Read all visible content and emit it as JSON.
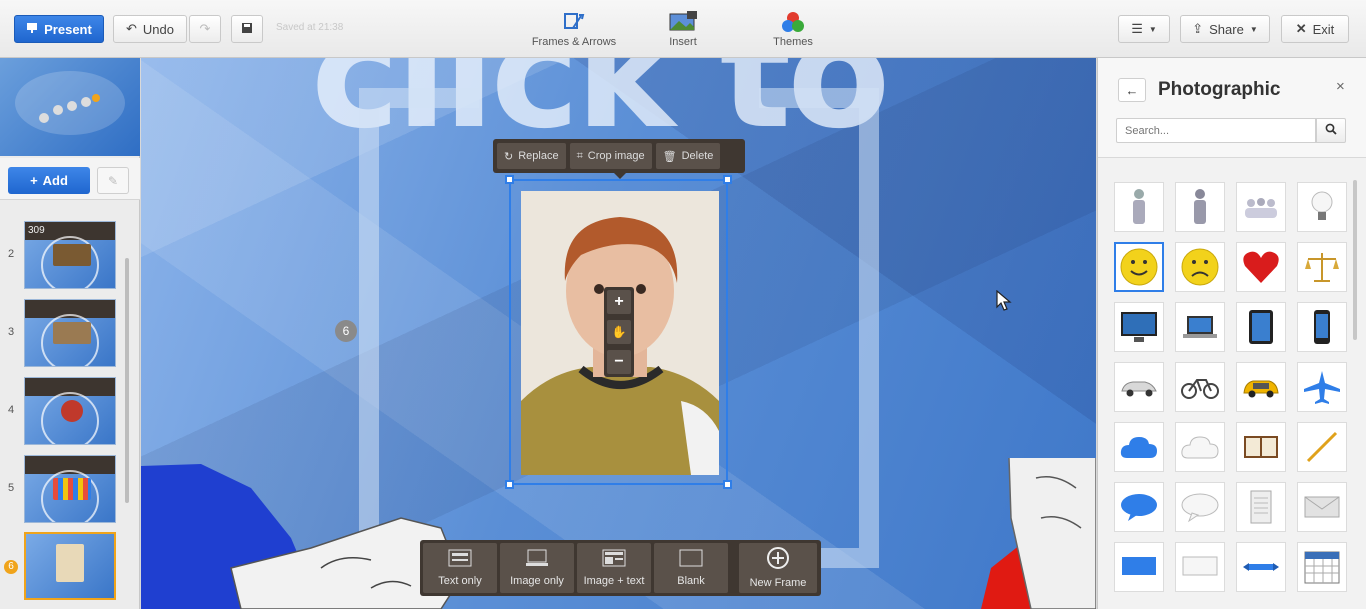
{
  "toolbar": {
    "present_label": "Present",
    "undo_label": "Undo",
    "saved_text": "Saved at 21:38",
    "share_label": "Share",
    "exit_label": "Exit",
    "nav": [
      {
        "label": "Frames & Arrows",
        "icon": "frames-arrows-icon"
      },
      {
        "label": "Insert",
        "icon": "insert-icon"
      },
      {
        "label": "Themes",
        "icon": "themes-icon"
      }
    ]
  },
  "sidebar": {
    "add_label": "Add",
    "slides": [
      {
        "number": "2",
        "header": "309"
      },
      {
        "number": "3",
        "header": ""
      },
      {
        "number": "4",
        "header": ""
      },
      {
        "number": "5",
        "header": ""
      },
      {
        "number": "6",
        "header": ""
      }
    ]
  },
  "canvas": {
    "title_text": "click to",
    "frame_number": "6",
    "context_menu": {
      "replace_label": "Replace",
      "crop_label": "Crop image",
      "delete_label": "Delete"
    },
    "zoom": {
      "plus": "+",
      "minus": "−"
    },
    "layouts": [
      {
        "label": "Text only"
      },
      {
        "label": "Image only"
      },
      {
        "label": "Image + text"
      },
      {
        "label": "Blank"
      },
      {
        "label": "New Frame"
      }
    ]
  },
  "panel": {
    "title": "Photographic",
    "search_placeholder": "Search...",
    "symbols": [
      "person-gray-icon",
      "person-gray-2-icon",
      "group-icon",
      "lightbulb-icon",
      "smiley-happy-icon",
      "smiley-sad-icon",
      "heart-icon",
      "scales-icon",
      "monitor-icon",
      "laptop-icon",
      "tablet-icon",
      "phone-icon",
      "car-icon",
      "bicycle-icon",
      "taxi-icon",
      "airplane-icon",
      "cloud-blue-icon",
      "cloud-white-icon",
      "book-icon",
      "pencil-icon",
      "speech-bubble-blue-icon",
      "speech-bubble-white-icon",
      "document-icon",
      "envelope-icon",
      "banner-blue-icon",
      "banner-white-icon",
      "ribbon-icon",
      "calendar-icon"
    ]
  },
  "colors": {
    "accent": "#2f7ee8",
    "dark_toolbar": "#3f3731",
    "selected_slide": "#f0a41b"
  }
}
